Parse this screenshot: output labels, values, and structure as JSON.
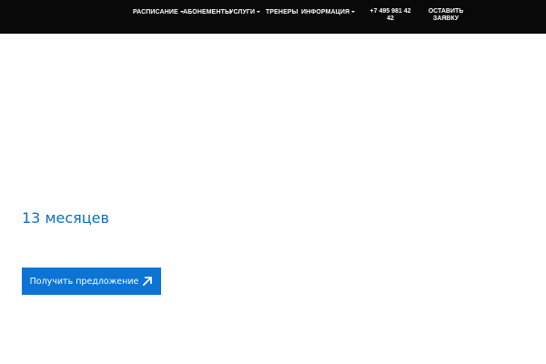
{
  "nav": {
    "items": [
      {
        "label": "РАСПИСАНИЕ",
        "has_dropdown": true
      },
      {
        "label": "АБОНЕМЕНТЫ",
        "has_dropdown": false
      },
      {
        "label": "УСЛУГИ",
        "has_dropdown": true
      },
      {
        "label": "ТРЕНЕРЫ",
        "has_dropdown": false
      },
      {
        "label": "ИНФОРМАЦИЯ",
        "has_dropdown": true
      }
    ],
    "phone_line1": "+7 495 981 42",
    "phone_line2": "42",
    "cta_line1": "ОСТАВИТЬ",
    "cta_line2": "ЗАЯВКУ"
  },
  "hero": {
    "headline": "13 месяцев",
    "button_label": "Получить предложение",
    "button_icon": "arrow-up-right-icon"
  },
  "colors": {
    "topbar_bg": "#090909",
    "accent_text": "#0b6fc2",
    "button_bg": "#0b74d4"
  }
}
